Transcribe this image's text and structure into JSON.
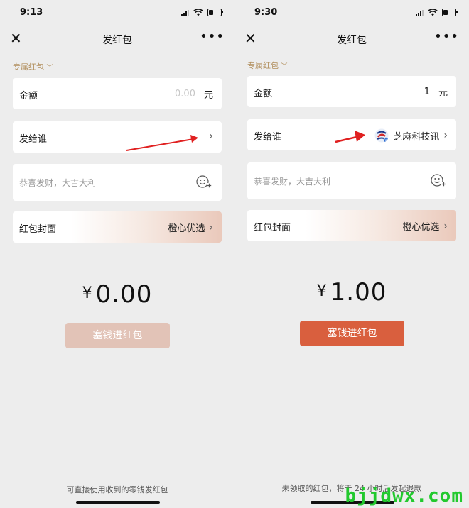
{
  "left": {
    "status": {
      "time": "9:13"
    },
    "nav": {
      "title": "发红包"
    },
    "category": "专属红包",
    "amount_row": {
      "label": "金额",
      "value": "0.00",
      "unit": "元"
    },
    "recipient_row": {
      "label": "发给谁"
    },
    "blessing_placeholder": "恭喜发财，大吉大利",
    "cover_row": {
      "label": "红包封面",
      "value": "橙心优选"
    },
    "total": {
      "currency": "¥",
      "amount": "0.00"
    },
    "button": {
      "label": "塞钱进红包",
      "state": "disabled"
    },
    "footer": "可直接使用收到的零钱发红包"
  },
  "right": {
    "status": {
      "time": "9:30"
    },
    "nav": {
      "title": "发红包"
    },
    "category": "专属红包",
    "amount_row": {
      "label": "金额",
      "value": "1",
      "unit": "元"
    },
    "recipient_row": {
      "label": "发给谁",
      "value": "芝麻科技讯"
    },
    "blessing_placeholder": "恭喜发财，大吉大利",
    "cover_row": {
      "label": "红包封面",
      "value": "橙心优选"
    },
    "total": {
      "currency": "¥",
      "amount": "1.00"
    },
    "button": {
      "label": "塞钱进红包",
      "state": "enabled"
    },
    "footer": "未领取的红包，将于 24 小时后发起退款"
  },
  "watermark": "bjjdwx.com",
  "colors": {
    "accent_gold": "#b39160",
    "button_disabled": "#e2c3b7",
    "button_active": "#d95f3e",
    "annotation_arrow": "#e02020",
    "watermark": "#22c92e"
  },
  "icons": [
    "close-icon",
    "more-icon",
    "chevron-down-icon",
    "chevron-right-icon",
    "emoji-add-icon",
    "signal-icon",
    "wifi-icon",
    "battery-icon"
  ]
}
